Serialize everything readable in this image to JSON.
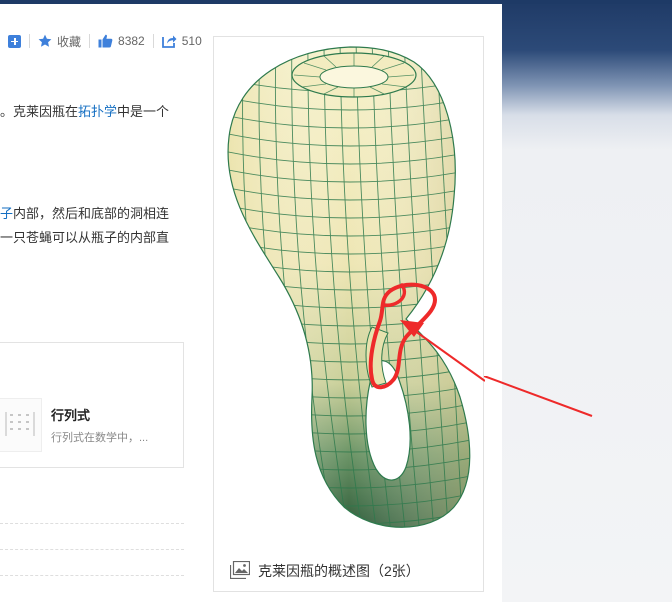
{
  "toolbar": {
    "favorite_label": "收藏",
    "like_count": "8382",
    "share_count": "510"
  },
  "article": {
    "line1_text": "。克莱因瓶在",
    "line1_link": "拓扑学",
    "line1_tail": "中是一个",
    "line2_link": "子",
    "line2_tail": "内部，然后和底部的洞相连",
    "line3_text": "一只苍蝇可以从瓶子的内部直"
  },
  "related_card": {
    "title": "行列式",
    "description": "行列式在数学中，..."
  },
  "album": {
    "caption": "克莱因瓶的概述图（2张）"
  },
  "colors": {
    "link": "#136ec2",
    "accent_blue": "#3e80db",
    "annotation_red": "#ee2a2a",
    "mesh_green": "#2e7a4d"
  }
}
